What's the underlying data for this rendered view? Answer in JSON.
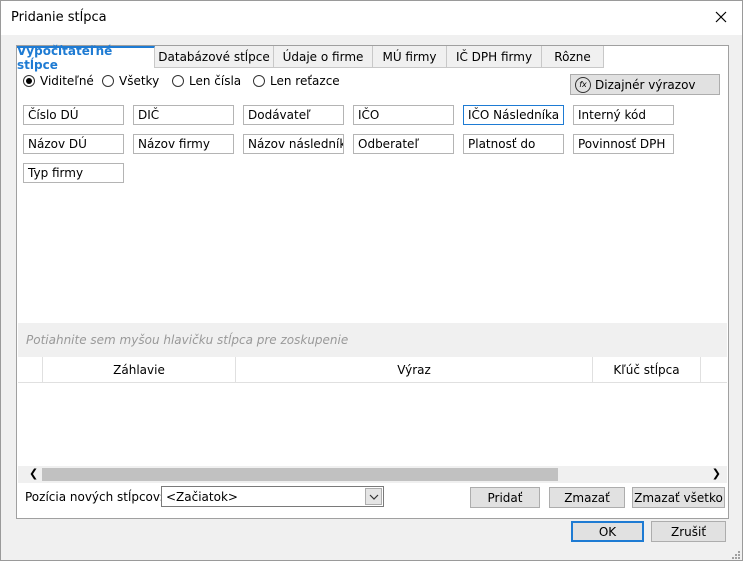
{
  "window": {
    "title": "Pridanie stĺpca"
  },
  "tabs": [
    {
      "label": "Vypočítateľné stĺpce"
    },
    {
      "label": "Databázové stĺpce"
    },
    {
      "label": "Údaje o firme"
    },
    {
      "label": "MÚ firmy"
    },
    {
      "label": "IČ DPH firmy"
    },
    {
      "label": "Rôzne"
    }
  ],
  "filters": [
    {
      "label": "Viditeľné",
      "checked": true
    },
    {
      "label": "Všetky",
      "checked": false
    },
    {
      "label": "Len čísla",
      "checked": false
    },
    {
      "label": "Len reťazce",
      "checked": false
    }
  ],
  "designer_button": {
    "label": "Dizajnér výrazov",
    "icon": "fx-icon"
  },
  "columns": [
    "Číslo DÚ",
    "DIČ",
    "Dodávateľ",
    "IČO",
    "IČO Následníka",
    "Interný kód",
    "Názov DÚ",
    "Názov firmy",
    "Názov následníka",
    "Odberateľ",
    "Platnosť do",
    "Povinnosť DPH",
    "Typ firmy"
  ],
  "group_hint": "Potiahnite sem myšou hlavičku stĺpca pre zoskupenie",
  "grid_headers": {
    "header": "Záhlavie",
    "expression": "Výraz",
    "key": "Kľúč stĺpca"
  },
  "position": {
    "label": "Pozícia nových stĺpcov:",
    "value": "<Začiatok>"
  },
  "actions": {
    "add": "Pridať",
    "delete": "Zmazať",
    "delete_all": "Zmazať všetko"
  },
  "dialog_buttons": {
    "ok": "OK",
    "cancel": "Zrušiť"
  },
  "colors": {
    "accent": "#1e7bd3"
  }
}
